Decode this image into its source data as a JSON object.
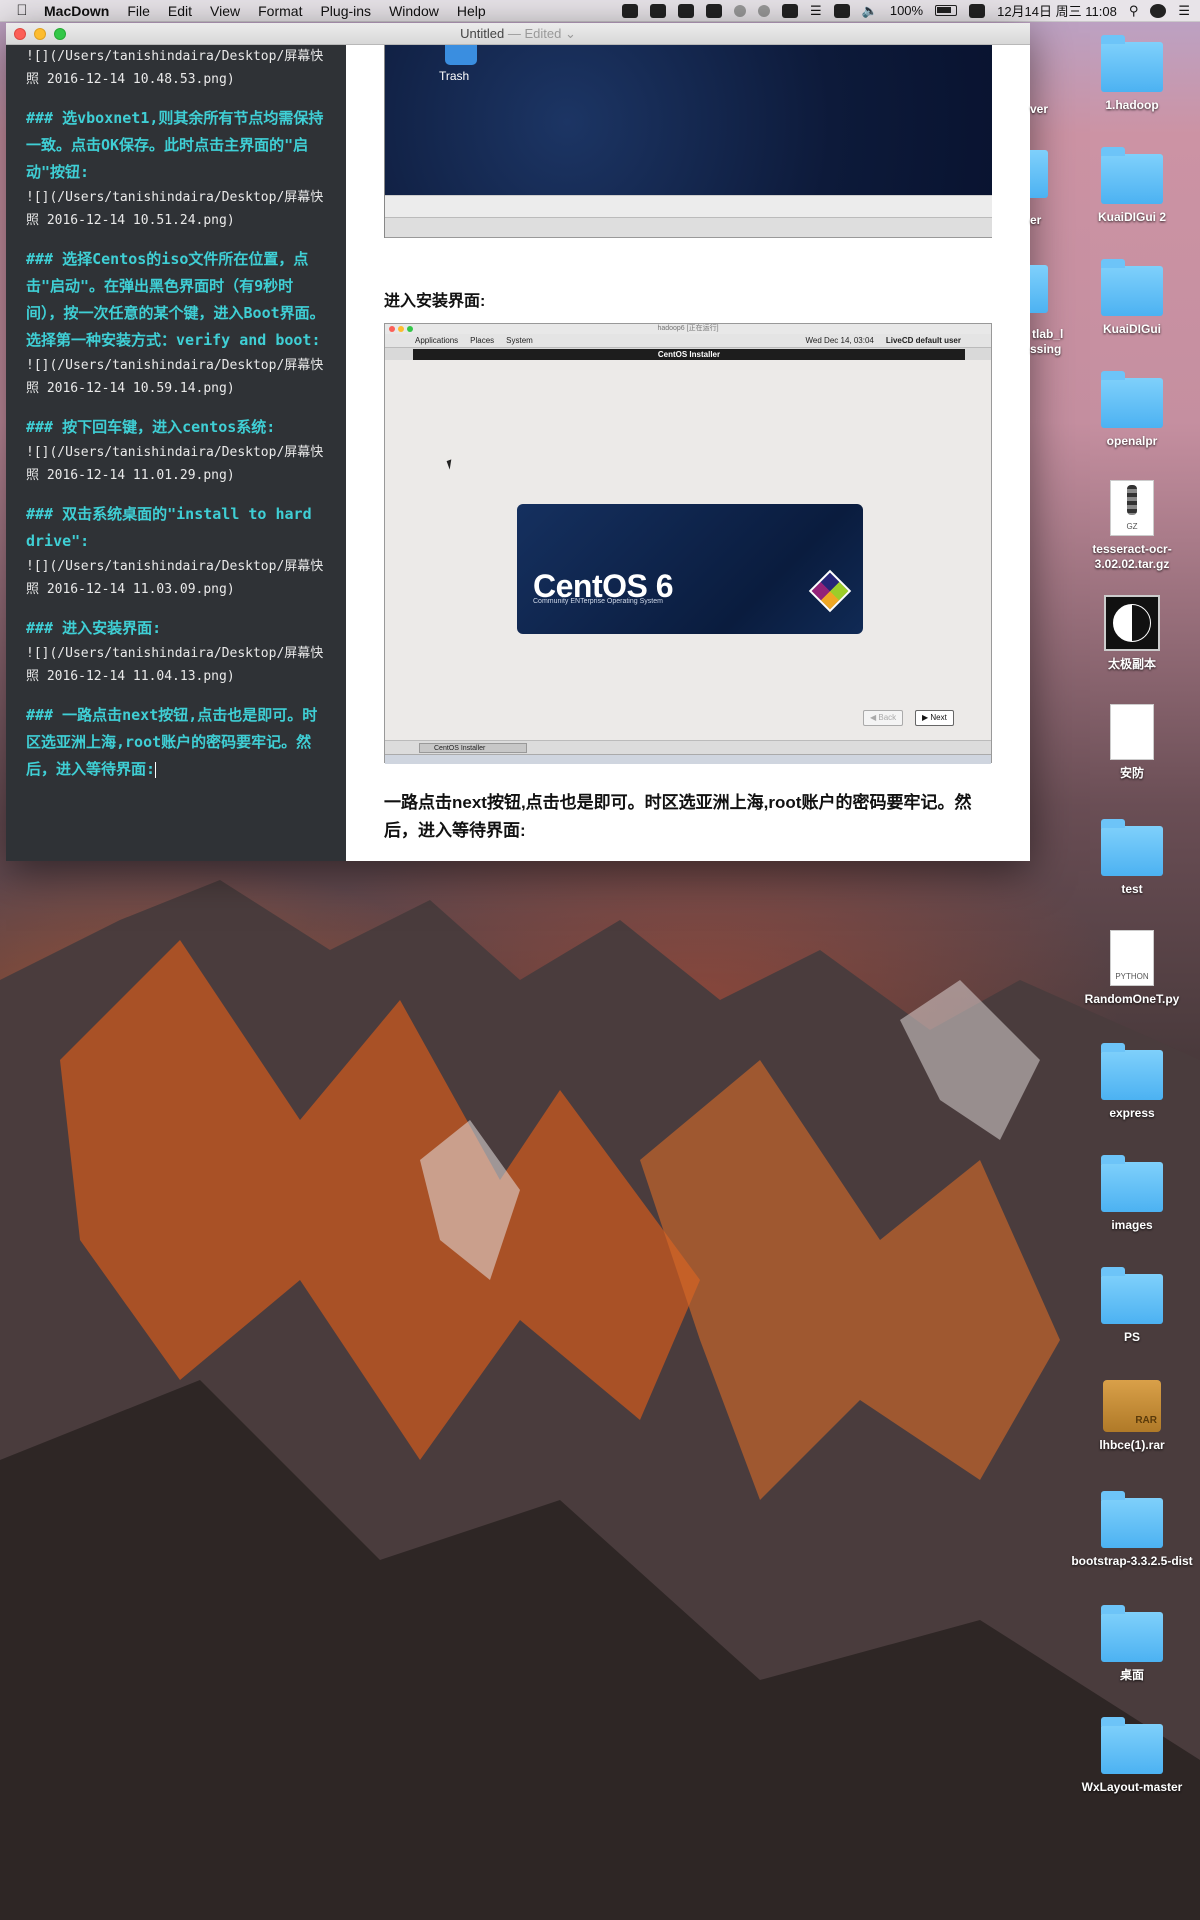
{
  "menubar": {
    "app_name": "MacDown",
    "menus": [
      "File",
      "Edit",
      "View",
      "Format",
      "Plug-ins",
      "Window",
      "Help"
    ],
    "battery": "100%",
    "datetime": "12月14日 周三 11:08"
  },
  "window": {
    "title": "Untitled",
    "edited": "— Edited"
  },
  "editor": {
    "blocks": [
      {
        "heading": "",
        "path": "![](/Users/tanishindaira/Desktop/屏幕快照 2016-12-14 10.48.53.png)"
      },
      {
        "heading": "### 选vboxnet1,则其余所有节点均需保持一致。点击OK保存。此时点击主界面的\"启动\"按钮:",
        "path": "![](/Users/tanishindaira/Desktop/屏幕快照 2016-12-14 10.51.24.png)"
      },
      {
        "heading": "### 选择Centos的iso文件所在位置，点击\"启动\"。在弹出黑色界面时（有9秒时间），按一次任意的某个键，进入Boot界面。选择第一种安装方式：verify and boot:",
        "path": "![](/Users/tanishindaira/Desktop/屏幕快照 2016-12-14 10.59.14.png)"
      },
      {
        "heading": "### 按下回车键，进入centos系统:",
        "path": "![](/Users/tanishindaira/Desktop/屏幕快照 2016-12-14 11.01.29.png)"
      },
      {
        "heading": "### 双击系统桌面的\"install to hard drive\":",
        "path": "![](/Users/tanishindaira/Desktop/屏幕快照 2016-12-14 11.03.09.png)"
      },
      {
        "heading": "### 进入安装界面:",
        "path": "![](/Users/tanishindaira/Desktop/屏幕快照 2016-12-14 11.04.13.png)"
      },
      {
        "heading": "### 一路点击next按钮,点击也是即可。时区选亚洲上海,root账户的密码要牢记。然后，进入等待界面:",
        "path": ""
      }
    ]
  },
  "preview": {
    "trash_label": "Trash",
    "heading1": "进入安装界面:",
    "vm": {
      "window_title": "hadoop6 [正在运行]",
      "menus": [
        "Applications",
        "Places",
        "System"
      ],
      "clock": "Wed Dec 14, 03:04",
      "user": "LiveCD default user",
      "installer_title": "CentOS Installer",
      "brand": "CentOS 6",
      "brand_sub": "Community ENTerprise Operating System",
      "back_label": "Back",
      "next_label": "Next",
      "task_label": "CentOS Installer"
    },
    "paragraph": "一路点击next按钮,点击也是即可。时区选亚洲上海,root账户的密码要牢记。然后，进入等待界面:"
  },
  "desktop": {
    "partial_labels": [
      "ver",
      "er",
      "tlab_l",
      "ssing"
    ],
    "icons": [
      {
        "label": "1.hadoop",
        "kind": "folder"
      },
      {
        "label": "KuaiDIGui 2",
        "kind": "folder"
      },
      {
        "label": "KuaiDIGui",
        "kind": "folder"
      },
      {
        "label": "openalpr",
        "kind": "folder"
      },
      {
        "label": "tesseract-ocr-3.02.02.tar.gz",
        "kind": "archive",
        "tag": "GZ"
      },
      {
        "label": "太极副本",
        "kind": "image"
      },
      {
        "label": "安防",
        "kind": "document"
      },
      {
        "label": "test",
        "kind": "folder"
      },
      {
        "label": "RandomOneT.py",
        "kind": "python",
        "tag": "PYTHON"
      },
      {
        "label": "express",
        "kind": "folder"
      },
      {
        "label": "images",
        "kind": "folder"
      },
      {
        "label": "PS",
        "kind": "folder"
      },
      {
        "label": "lhbce(1).rar",
        "kind": "rar"
      },
      {
        "label": "bootstrap-3.3.2.5-dist",
        "kind": "folder"
      },
      {
        "label": "桌面",
        "kind": "folder"
      },
      {
        "label": "WxLayout-master",
        "kind": "folder"
      }
    ]
  }
}
